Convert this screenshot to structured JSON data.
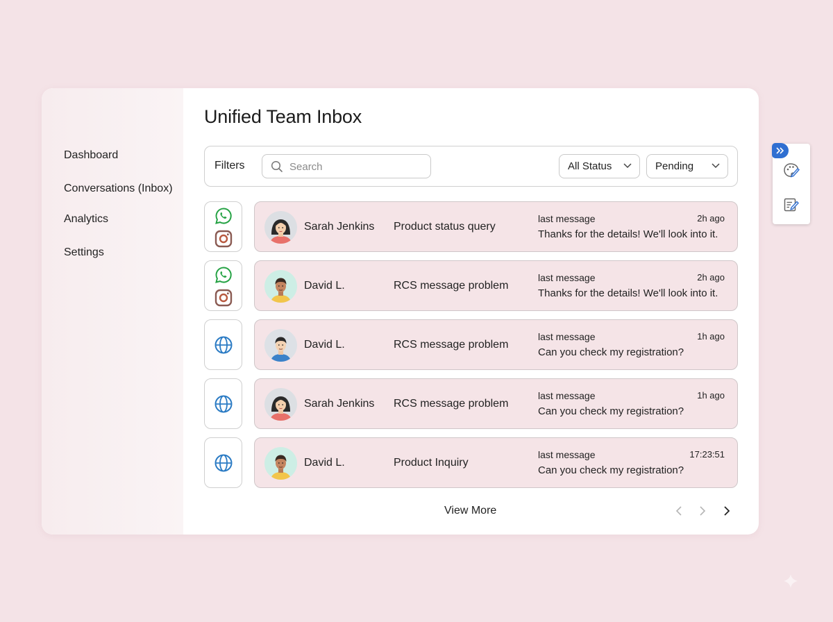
{
  "sidebar": {
    "items": [
      {
        "label": "Dashboard"
      },
      {
        "label": "Conversations (Inbox)"
      },
      {
        "label": "Analytics"
      },
      {
        "label": "Settings"
      }
    ]
  },
  "page": {
    "title": "Unified Team Inbox"
  },
  "filters": {
    "label": "Filters",
    "search_placeholder": "Search",
    "status_select": "All Status",
    "state_select": "Pending"
  },
  "conversations": [
    {
      "channels": [
        "whatsapp",
        "instagram"
      ],
      "avatar": "woman-avatar",
      "name": "Sarah Jenkins",
      "subject": "Product status query",
      "last_label": "last message",
      "last_message": "Thanks for the details! We'll look into it.",
      "time": "2h ago"
    },
    {
      "channels": [
        "whatsapp",
        "instagram"
      ],
      "avatar": "man-avatar",
      "name": "David L.",
      "subject": "RCS message problem",
      "last_label": "last message",
      "last_message": "Thanks for the details! We'll look into it.",
      "time": "2h ago"
    },
    {
      "channels": [
        "web"
      ],
      "avatar": "man-avatar",
      "name": "David L.",
      "subject": "RCS message problem",
      "last_label": "last message",
      "last_message": "Can you check my registration?",
      "time": "1h ago"
    },
    {
      "channels": [
        "web"
      ],
      "avatar": "woman-avatar",
      "name": "Sarah Jenkins",
      "subject": "RCS message problem",
      "last_label": "last message",
      "last_message": "Can you check my registration?",
      "time": "1h ago"
    },
    {
      "channels": [
        "web"
      ],
      "avatar": "man-avatar",
      "name": "David L.",
      "subject": "Product Inquiry",
      "last_label": "last message",
      "last_message": "Can you check my registration?",
      "time": "17:23:51"
    }
  ],
  "footer": {
    "view_more": "View More"
  },
  "icons": {
    "whatsapp": "whatsapp-icon",
    "instagram": "instagram-icon",
    "web": "globe-icon",
    "search": "search-icon",
    "palette": "palette-icon",
    "edit": "edit-icon"
  },
  "colors": {
    "background": "#f4e3e7",
    "row_background": "#f5e4e7",
    "whatsapp": "#25a244",
    "globe": "#2b7bc4",
    "accent": "#2f6fd1"
  }
}
